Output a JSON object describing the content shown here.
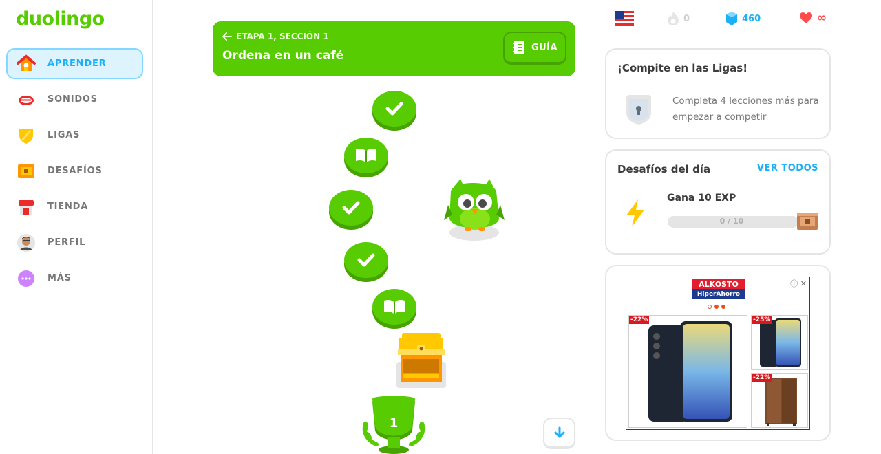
{
  "sidebar": {
    "logo": "duolingo",
    "items": [
      {
        "label": "APRENDER",
        "icon": "home-icon"
      },
      {
        "label": "SONIDOS",
        "icon": "mouth-icon"
      },
      {
        "label": "LIGAS",
        "icon": "shield-icon"
      },
      {
        "label": "DESAFÍOS",
        "icon": "chest-icon"
      },
      {
        "label": "TIENDA",
        "icon": "shop-icon"
      },
      {
        "label": "PERFIL",
        "icon": "avatar-icon"
      },
      {
        "label": "MÁS",
        "icon": "more-icon"
      }
    ]
  },
  "unit": {
    "stage": "ETAPA 1, SECCIÓN 1",
    "title": "Ordena en un café",
    "guide_label": "GUÍA"
  },
  "path": {
    "trophy_number": "1"
  },
  "stats": {
    "streak": "0",
    "gems": "460",
    "hearts": "∞"
  },
  "leagues": {
    "title": "¡Compite en las Ligas!",
    "text": "Completa 4 lecciones más para empezar a competir"
  },
  "daily": {
    "title": "Desafíos del día",
    "see_all": "VER TODOS",
    "quest": "Gana 10 EXP",
    "progress_text": "0 / 10",
    "progress_fraction": 0
  },
  "ad": {
    "brand_top": "ALKOSTO",
    "brand_bottom": "HiperAhorro",
    "discounts": [
      "-22%",
      "-25%",
      "-22%"
    ]
  },
  "colors": {
    "green": "#58cc02",
    "blue": "#1cb0f6",
    "red": "#ff4b4b"
  }
}
